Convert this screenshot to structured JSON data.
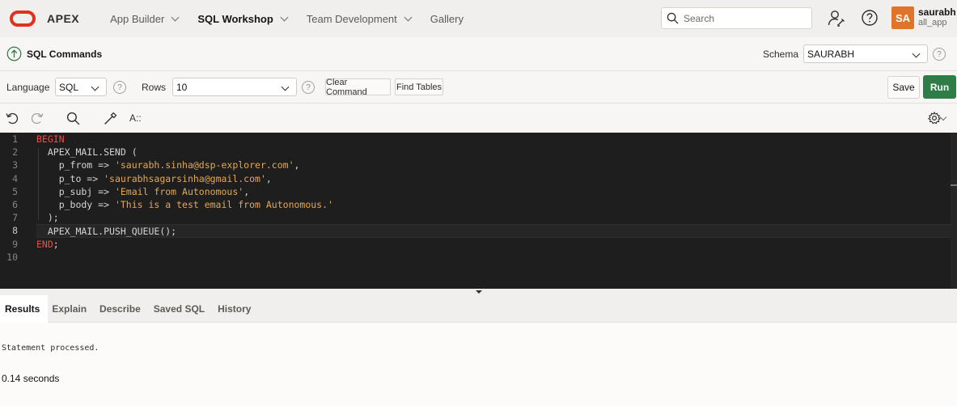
{
  "brand": {
    "name": "APEX",
    "logo_color": "#e0311f"
  },
  "nav": {
    "menus": [
      {
        "label": "App Builder"
      },
      {
        "label": "SQL Workshop"
      },
      {
        "label": "Team Development"
      },
      {
        "label": "Gallery"
      }
    ],
    "search_placeholder": "Search"
  },
  "user": {
    "initials": "SA",
    "name": "saurabh",
    "workspace": "all_app",
    "avatar_color": "#e07529"
  },
  "page": {
    "title": "SQL Commands",
    "schema_label": "Schema",
    "schema_value": "SAURABH"
  },
  "toolbar": {
    "language_label": "Language",
    "language_value": "SQL",
    "rows_label": "Rows",
    "rows_value": "10",
    "help_glyph": "?",
    "clear_label": "Clear Command",
    "find_tables_label": "Find Tables",
    "save_label": "Save",
    "run_label": "Run",
    "run_color": "#2e7d46"
  },
  "editor_tools": {
    "format_label": "A::"
  },
  "editor": {
    "current_line": 8,
    "line_numbers": [
      "1",
      "2",
      "3",
      "4",
      "5",
      "6",
      "7",
      "8",
      "9",
      "10"
    ],
    "lines": [
      [
        {
          "t": "BEGIN",
          "c": "kw"
        }
      ],
      [
        {
          "t": "  APEX_MAIL.SEND (",
          "c": ""
        }
      ],
      [
        {
          "t": "    p_from => ",
          "c": ""
        },
        {
          "t": "'saurabh.sinha@dsp-explorer.com'",
          "c": "str"
        },
        {
          "t": ",",
          "c": ""
        }
      ],
      [
        {
          "t": "    p_to => ",
          "c": ""
        },
        {
          "t": "'saurabhsagarsinha@gmail.com'",
          "c": "str"
        },
        {
          "t": ",",
          "c": ""
        }
      ],
      [
        {
          "t": "    p_subj => ",
          "c": ""
        },
        {
          "t": "'Email from Autonomous'",
          "c": "str"
        },
        {
          "t": ",",
          "c": ""
        }
      ],
      [
        {
          "t": "    p_body => ",
          "c": ""
        },
        {
          "t": "'This is a test email from Autonomous.'",
          "c": "str"
        }
      ],
      [
        {
          "t": "  );",
          "c": ""
        }
      ],
      [
        {
          "t": "  APEX_MAIL.PUSH_QUEUE();",
          "c": ""
        }
      ],
      [
        {
          "t": "END",
          "c": "kw"
        },
        {
          "t": ";",
          "c": ""
        }
      ],
      [
        {
          "t": "",
          "c": ""
        }
      ]
    ]
  },
  "results": {
    "tabs": [
      {
        "label": "Results"
      },
      {
        "label": "Explain"
      },
      {
        "label": "Describe"
      },
      {
        "label": "Saved SQL"
      },
      {
        "label": "History"
      }
    ],
    "active_tab": 0,
    "message": "Statement processed.",
    "elapsed": "0.14 seconds"
  }
}
